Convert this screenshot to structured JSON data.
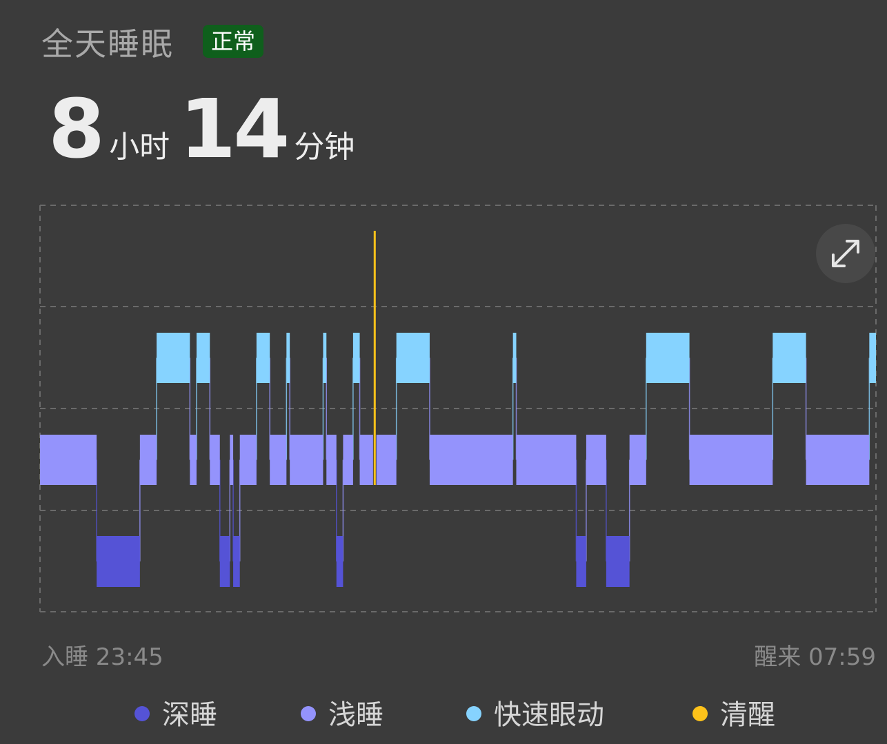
{
  "header": {
    "title": "全天睡眠",
    "status_badge": "正常"
  },
  "duration": {
    "hours": "8",
    "hours_unit": "小时",
    "minutes": "14",
    "minutes_unit": "分钟"
  },
  "times": {
    "sleep_label": "入睡 23:45",
    "wake_label": "醒来 07:59"
  },
  "legend": [
    {
      "label": "深睡",
      "color": "#5553d6"
    },
    {
      "label": "浅睡",
      "color": "#9493fc"
    },
    {
      "label": "快速眼动",
      "color": "#86d3ff"
    },
    {
      "label": "清醒",
      "color": "#fdc21a"
    }
  ],
  "icons": {
    "expand": "expand-icon"
  },
  "chart_data": {
    "type": "sleep-stage-timeline",
    "start": "23:45",
    "end": "07:59",
    "stages": [
      "清醒",
      "快速眼动",
      "浅睡",
      "深睡"
    ],
    "segments": [
      {
        "stage": "浅睡",
        "start": 0,
        "end": 17
      },
      {
        "stage": "深睡",
        "start": 17,
        "end": 30
      },
      {
        "stage": "浅睡",
        "start": 30,
        "end": 35
      },
      {
        "stage": "快速眼动",
        "start": 35,
        "end": 45
      },
      {
        "stage": "浅睡",
        "start": 45,
        "end": 47
      },
      {
        "stage": "快速眼动",
        "start": 47,
        "end": 51
      },
      {
        "stage": "浅睡",
        "start": 51,
        "end": 54
      },
      {
        "stage": "深睡",
        "start": 54,
        "end": 57
      },
      {
        "stage": "浅睡",
        "start": 57,
        "end": 58
      },
      {
        "stage": "深睡",
        "start": 58,
        "end": 60
      },
      {
        "stage": "浅睡",
        "start": 60,
        "end": 65
      },
      {
        "stage": "快速眼动",
        "start": 65,
        "end": 69
      },
      {
        "stage": "浅睡",
        "start": 69,
        "end": 74
      },
      {
        "stage": "快速眼动",
        "start": 74,
        "end": 75
      },
      {
        "stage": "浅睡",
        "start": 75,
        "end": 85
      },
      {
        "stage": "快速眼动",
        "start": 85,
        "end": 86
      },
      {
        "stage": "浅睡",
        "start": 86,
        "end": 89
      },
      {
        "stage": "深睡",
        "start": 89,
        "end": 91
      },
      {
        "stage": "浅睡",
        "start": 91,
        "end": 94
      },
      {
        "stage": "快速眼动",
        "start": 94,
        "end": 96
      },
      {
        "stage": "浅睡",
        "start": 96,
        "end": 100
      },
      {
        "stage": "清醒",
        "start": 100,
        "end": 101
      },
      {
        "stage": "浅睡",
        "start": 101,
        "end": 107
      },
      {
        "stage": "快速眼动",
        "start": 107,
        "end": 117
      },
      {
        "stage": "浅睡",
        "start": 117,
        "end": 142
      },
      {
        "stage": "快速眼动",
        "start": 142,
        "end": 143
      },
      {
        "stage": "浅睡",
        "start": 143,
        "end": 161
      },
      {
        "stage": "深睡",
        "start": 161,
        "end": 164
      },
      {
        "stage": "浅睡",
        "start": 164,
        "end": 170
      },
      {
        "stage": "深睡",
        "start": 170,
        "end": 177
      },
      {
        "stage": "浅睡",
        "start": 177,
        "end": 182
      },
      {
        "stage": "快速眼动",
        "start": 182,
        "end": 195
      },
      {
        "stage": "浅睡",
        "start": 195,
        "end": 220
      },
      {
        "stage": "快速眼动",
        "start": 220,
        "end": 230
      },
      {
        "stage": "浅睡",
        "start": 230,
        "end": 249
      },
      {
        "stage": "快速眼动",
        "start": 249,
        "end": 251
      }
    ],
    "total_duration": "8小时14分钟"
  }
}
